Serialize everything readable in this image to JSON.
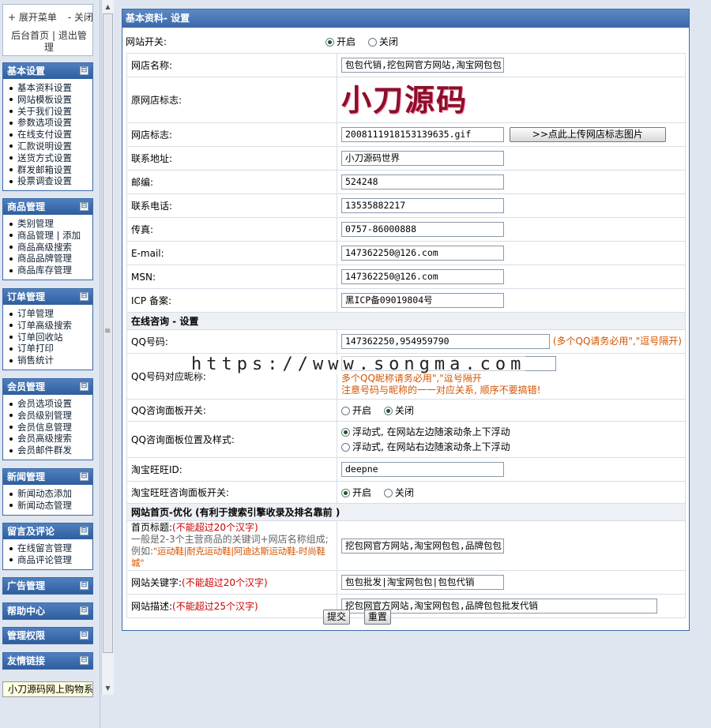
{
  "left": {
    "expand_menu": "+ 展开菜单",
    "close": "- 关闭",
    "admin_home": "后台首页",
    "separator": "|",
    "logout": "退出管理",
    "sections": [
      {
        "title": "基本设置",
        "items": [
          "基本资料设置",
          "网站模板设置",
          "关于我们设置",
          "参数选项设置",
          "在线支付设置",
          "汇款说明设置",
          "送货方式设置",
          "群发邮箱设置",
          "投票调查设置"
        ]
      },
      {
        "title": "商品管理",
        "items": [
          "类别管理",
          "商品管理 | 添加",
          "商品高级搜索",
          "商品品牌管理",
          "商品库存管理"
        ]
      },
      {
        "title": "订单管理",
        "items": [
          "订单管理",
          "订单高级搜索",
          "订单回收站",
          "订单打印",
          "销售统计"
        ]
      },
      {
        "title": "会员管理",
        "items": [
          "会员选项设置",
          "会员级别管理",
          "会员信息管理",
          "会员高级搜索",
          "会员邮件群发"
        ]
      },
      {
        "title": "新闻管理",
        "items": [
          "新闻动态添加",
          "新闻动态管理"
        ]
      },
      {
        "title": "留言及评论",
        "items": [
          "在线留言管理",
          "商品评论管理"
        ]
      },
      {
        "title": "广告管理",
        "items": []
      },
      {
        "title": "帮助中心",
        "items": []
      },
      {
        "title": "管理权限",
        "items": []
      },
      {
        "title": "友情链接",
        "items": []
      }
    ],
    "bottom_text": "小刀源码网上购物系",
    "toggle_icon": "⊟"
  },
  "main": {
    "title": "基本资料- 设置",
    "site_switch_label": "网站开关:",
    "on": "开启",
    "off": "关闭",
    "fields": {
      "shop_name_label": "网店名称:",
      "shop_name_value": "包包代销,挖包网官方网站,淘宝网包包",
      "orig_logo_label": "原网店标志:",
      "logo_text": "小刀源码",
      "logo_label": "网店标志:",
      "logo_value": "2008111918153139635.gif",
      "upload_button": ">>点此上传网店标志图片",
      "address_label": "联系地址:",
      "address_value": "小刀源码世界",
      "zip_label": "邮编:",
      "zip_value": "524248",
      "phone_label": "联系电话:",
      "phone_value": "13535882217",
      "fax_label": "传真:",
      "fax_value": "0757-86000888",
      "email_label": "E-mail:",
      "email_value": "147362250@126.com",
      "msn_label": "MSN:",
      "msn_value": "147362250@126.com",
      "icp_label": "ICP 备案:",
      "icp_value": "黑ICP备09019804号"
    },
    "consult_section": "在线咨询 - 设置",
    "consult": {
      "qq_label": "QQ号码:",
      "qq_value": "147362250,954959790",
      "qq_note": "(多个QQ请务必用\",\"逗号隔开)",
      "qq_name_label": "QQ号码对应昵称:",
      "qq_name_note1": "多个QQ昵称请务必用\",\"逗号隔开",
      "qq_name_note2": "注意号码与昵称的一一对应关系, 顺序不要搞错!",
      "panel_switch_label": "QQ咨询面板开关:",
      "panel_pos_label": "QQ咨询面板位置及样式:",
      "panel_pos_opt1": "浮动式, 在网站左边随滚动条上下浮动",
      "panel_pos_opt2": "浮动式, 在网站右边随滚动条上下浮动",
      "wangwang_label": "淘宝旺旺ID:",
      "wangwang_value": "deepne",
      "wangwang_switch_label": "淘宝旺旺咨询面板开关:"
    },
    "seo_section": "网站首页-优化 (有利于搜索引擎收录及排名靠前 )",
    "seo": {
      "title_label": "首页标题:",
      "title_limit": "(不能超过20个汉字)",
      "title_hint": "一般是2-3个主营商品的关键词+网店名称组成;",
      "title_example_prefix": "例如:",
      "title_example": "\"运动鞋|耐克运动鞋|阿迪达斯运动鞋-时尚鞋城\"",
      "title_value": "挖包网官方网站,淘宝网包包,品牌包包",
      "keywords_label": "网站关键字:",
      "keywords_limit": "(不能超过20个汉字)",
      "keywords_value": "包包批发|淘宝网包包|包包代销",
      "desc_label": "网站描述:",
      "desc_limit": "(不能超过25个汉字)",
      "desc_value": "挖包网官方网站,淘宝网包包,品牌包包批发代销"
    },
    "submit": "提交",
    "reset": "重置"
  },
  "watermark": "https://www.songma.com"
}
